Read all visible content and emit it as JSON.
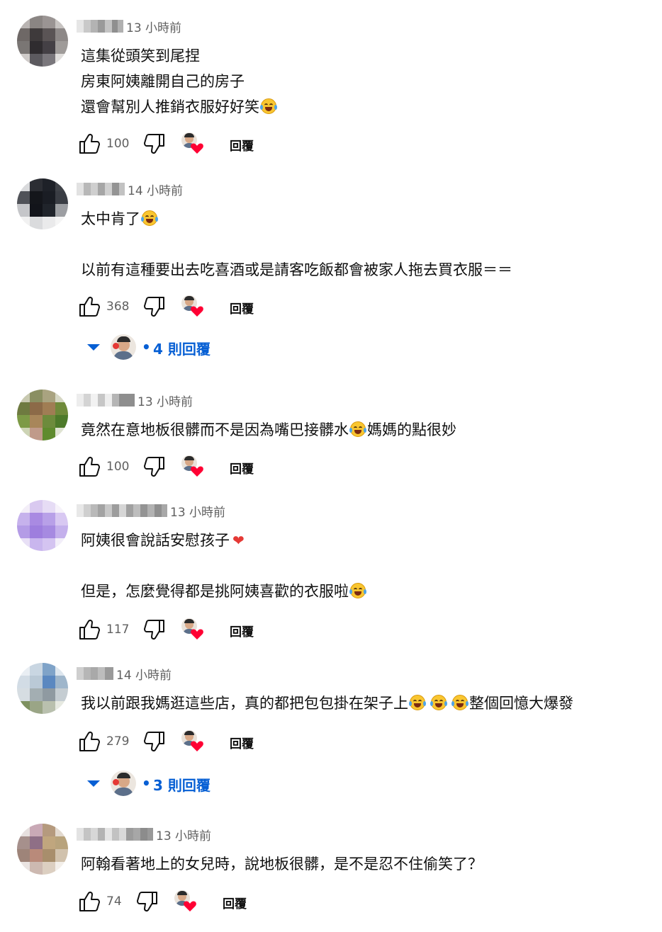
{
  "colors": {
    "text": "#0f0f0f",
    "secondary": "#606060",
    "link_blue": "#065fd4",
    "heart_red": "#ff0033"
  },
  "comments": [
    {
      "timestamp": "13 小時前",
      "lines": [
        "這集從頭笑到尾捏",
        "房東阿姨離開自己的房子",
        "還會幫別人推銷衣服好好笑"
      ],
      "like_count": "100",
      "reply_label": "回覆"
    },
    {
      "timestamp": "14 小時前",
      "lines": [
        "太中肯了",
        "",
        "以前有這種要出去吃喜酒或是請客吃飯都會被家人拖去買衣服＝＝"
      ],
      "like_count": "368",
      "reply_label": "回覆",
      "replies_label": "4 則回覆"
    },
    {
      "timestamp": "13 小時前",
      "lines": [
        "竟然在意地板很髒而不是因為嘴巴接髒水",
        "媽媽的點很妙"
      ],
      "like_count": "100",
      "reply_label": "回覆"
    },
    {
      "timestamp": "13 小時前",
      "lines": [
        "阿姨很會說話安慰孩子",
        "",
        "但是，怎麼覺得都是挑阿姨喜歡的衣服啦"
      ],
      "like_count": "117",
      "reply_label": "回覆"
    },
    {
      "timestamp": "14 小時前",
      "lines": [
        "我以前跟我媽逛這些店，真的都把包包掛在架子上",
        "整個回憶大爆發"
      ],
      "like_count": "279",
      "reply_label": "回覆",
      "replies_label": "3 則回覆"
    },
    {
      "timestamp": "13 小時前",
      "lines": [
        "阿翰看著地上的女兒時，說地板很髒，是不是忍不住偷笑了？"
      ],
      "like_count": "74",
      "reply_label": "回覆"
    }
  ],
  "icons": {
    "like": "thumb-up-icon",
    "dislike": "thumb-down-icon",
    "creator_heart": "creator-heart-icon",
    "expand": "chevron-down-icon",
    "emoji_laugh": "face-with-tears-of-joy-emoji",
    "emoji_heart": "red-heart-emoji"
  }
}
